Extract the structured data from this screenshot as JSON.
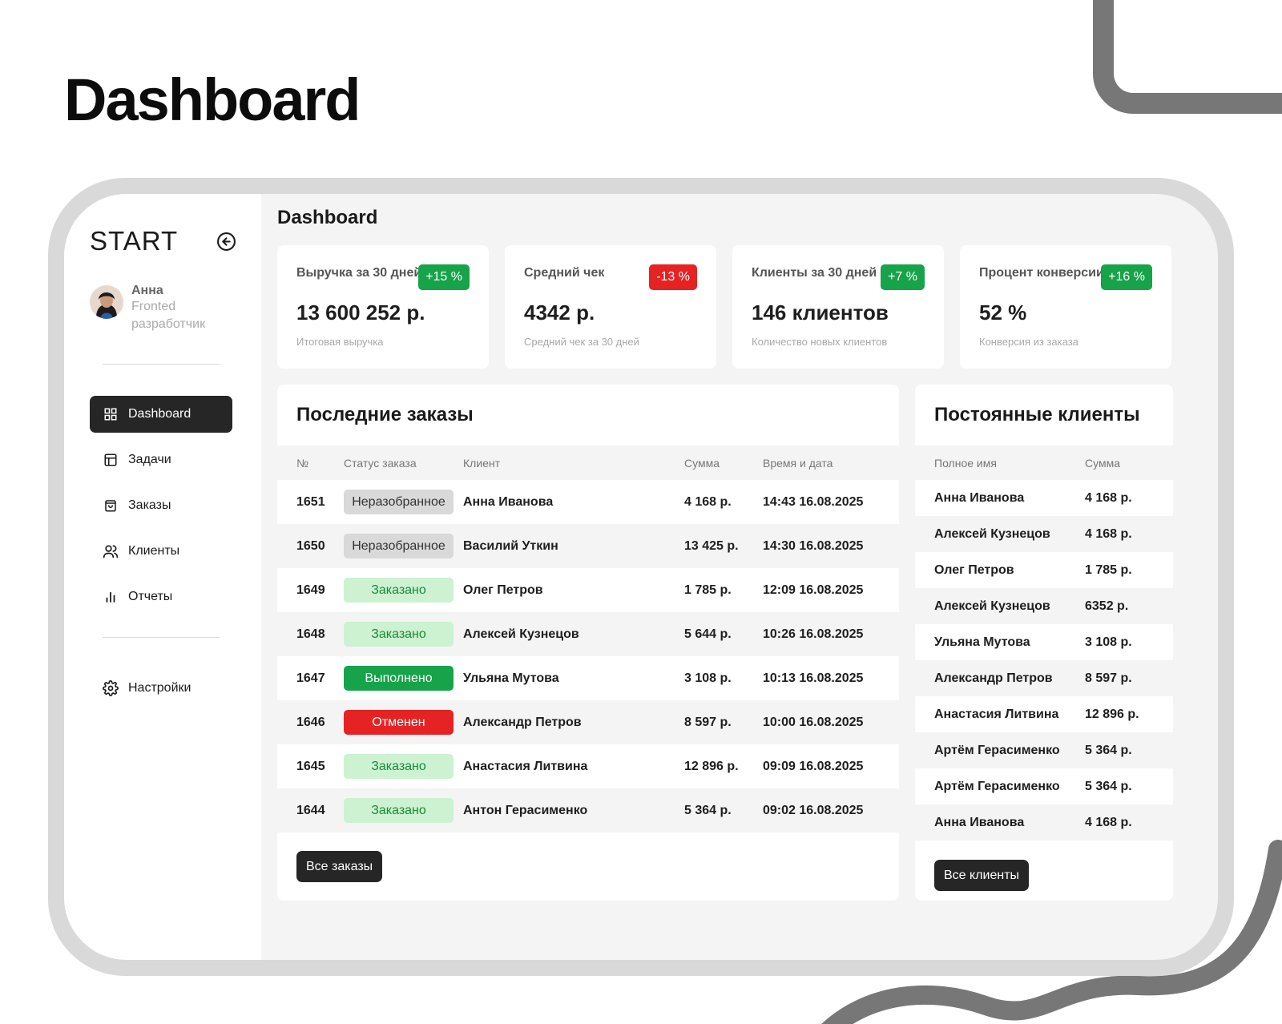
{
  "hero": {
    "title": "Dashboard"
  },
  "sidebar": {
    "brand": "START",
    "profile": {
      "name": "Анна",
      "role": "Fronted разработчик"
    },
    "nav": [
      {
        "label": "Dashboard",
        "icon": "grid-icon",
        "active": true
      },
      {
        "label": "Задачи",
        "icon": "table-icon",
        "active": false
      },
      {
        "label": "Заказы",
        "icon": "bag-icon",
        "active": false
      },
      {
        "label": "Клиенты",
        "icon": "users-icon",
        "active": false
      },
      {
        "label": "Отчеты",
        "icon": "bar-chart-icon",
        "active": false
      }
    ],
    "settings": {
      "label": "Настройки",
      "icon": "gear-icon"
    }
  },
  "main": {
    "title": "Dashboard",
    "cards": [
      {
        "label": "Выручка за 30 дней",
        "badge": "+15 %",
        "trend": "up",
        "value": "13 600 252 р.",
        "sub": "Итоговая выручка"
      },
      {
        "label": "Средний чек",
        "badge": "-13 %",
        "trend": "down",
        "value": "4342 р.",
        "sub": "Средний чек за 30 дней"
      },
      {
        "label": "Клиенты за 30 дней",
        "badge": "+7 %",
        "trend": "up",
        "value": "146 клиентов",
        "sub": "Количество новых клиентов"
      },
      {
        "label": "Процент конверсии",
        "badge": "+16 %",
        "trend": "up",
        "value": "52 %",
        "sub": "Конверсия из заказа"
      }
    ],
    "orders": {
      "title": "Последние заказы",
      "columns": [
        "№",
        "Статус заказа",
        "Клиент",
        "Сумма",
        "Время и дата"
      ],
      "rows": [
        {
          "num": "1651",
          "status": "Неразобранное",
          "status_type": "new",
          "client": "Анна Иванова",
          "sum": "4 168 р.",
          "date": "14:43 16.08.2025"
        },
        {
          "num": "1650",
          "status": "Неразобранное",
          "status_type": "new",
          "client": "Василий Уткин",
          "sum": "13 425 р.",
          "date": "14:30 16.08.2025"
        },
        {
          "num": "1649",
          "status": "Заказано",
          "status_type": "ordered",
          "client": "Олег Петров",
          "sum": "1 785 р.",
          "date": "12:09 16.08.2025"
        },
        {
          "num": "1648",
          "status": "Заказано",
          "status_type": "ordered",
          "client": "Алексей Кузнецов",
          "sum": "5 644 р.",
          "date": "10:26 16.08.2025"
        },
        {
          "num": "1647",
          "status": "Выполнено",
          "status_type": "done",
          "client": "Ульяна Мутова",
          "sum": "3 108 р.",
          "date": "10:13 16.08.2025"
        },
        {
          "num": "1646",
          "status": "Отменен",
          "status_type": "cancel",
          "client": "Александр Петров",
          "sum": "8 597 р.",
          "date": "10:00 16.08.2025"
        },
        {
          "num": "1645",
          "status": "Заказано",
          "status_type": "ordered",
          "client": "Анастасия Литвина",
          "sum": "12 896 р.",
          "date": "09:09 16.08.2025"
        },
        {
          "num": "1644",
          "status": "Заказано",
          "status_type": "ordered",
          "client": "Антон Герасименко",
          "sum": "5 364 р.",
          "date": "09:02 16.08.2025"
        }
      ],
      "button": "Все заказы"
    },
    "clients": {
      "title": "Постоянные клиенты",
      "columns": [
        "Полное имя",
        "Сумма"
      ],
      "rows": [
        {
          "name": "Анна Иванова",
          "sum": "4 168 р."
        },
        {
          "name": "Алексей Кузнецов",
          "sum": "4 168 р."
        },
        {
          "name": "Олег Петров",
          "sum": "1 785 р."
        },
        {
          "name": "Алексей Кузнецов",
          "sum": "6352 р."
        },
        {
          "name": "Ульяна Мутова",
          "sum": "3 108 р."
        },
        {
          "name": "Александр Петров",
          "sum": "8 597 р."
        },
        {
          "name": "Анастасия Литвина",
          "sum": "12 896 р."
        },
        {
          "name": "Артём Герасименко",
          "sum": "5 364 р."
        },
        {
          "name": "Артём Герасименко",
          "sum": "5 364 р."
        },
        {
          "name": "Анна Иванова",
          "sum": "4 168 р."
        }
      ],
      "button": "Все клиенты"
    }
  },
  "colors": {
    "accent_dark": "#262626",
    "success": "#17a34a",
    "danger": "#e52323",
    "ordered_bg": "#ccf2d1",
    "neutral_bg": "#d9d9d9"
  }
}
